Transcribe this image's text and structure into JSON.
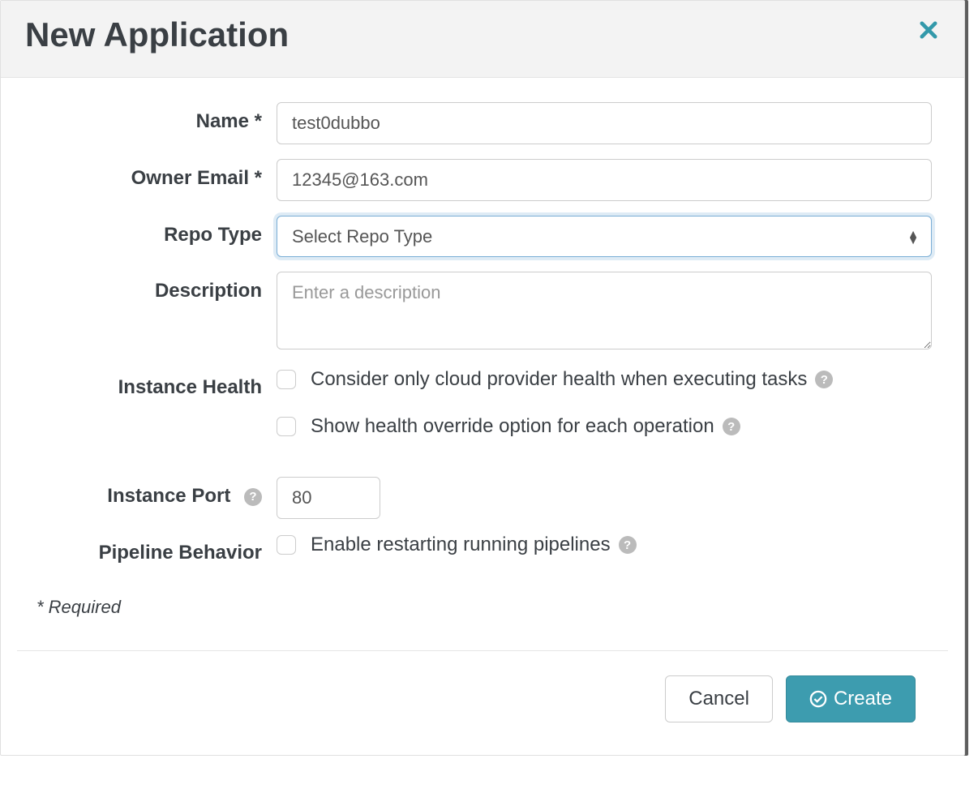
{
  "modal": {
    "title": "New Application",
    "requiredNote": "* Required"
  },
  "labels": {
    "name": "Name *",
    "ownerEmail": "Owner Email *",
    "repoType": "Repo Type",
    "description": "Description",
    "instanceHealth": "Instance Health",
    "instancePort": "Instance Port",
    "pipelineBehavior": "Pipeline Behavior"
  },
  "fields": {
    "name": "test0dubbo",
    "ownerEmail": "12345@163.com",
    "repoTypePlaceholder": "Select Repo Type",
    "descriptionPlaceholder": "Enter a description",
    "instancePort": "80"
  },
  "checks": {
    "cloudHealth": "Consider only cloud provider health when executing tasks",
    "showOverride": "Show health override option for each operation",
    "enableRestart": "Enable restarting running pipelines"
  },
  "footer": {
    "cancel": "Cancel",
    "create": "Create"
  }
}
